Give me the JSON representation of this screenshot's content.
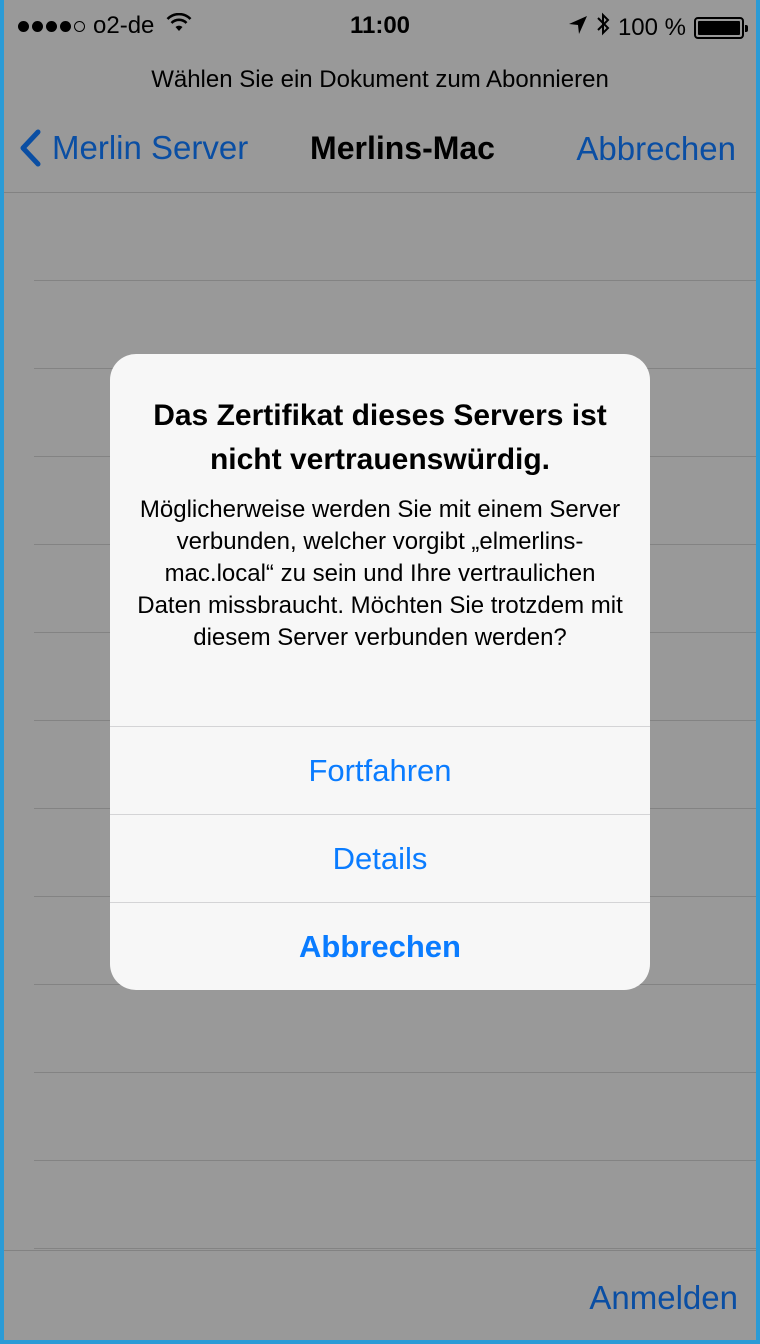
{
  "status_bar": {
    "carrier": "o2-de",
    "time": "11:00",
    "battery": "100 %",
    "signal_bars": 4,
    "signal_total": 5,
    "icons": [
      "wifi-icon",
      "location-icon",
      "bluetooth-icon",
      "battery-icon"
    ]
  },
  "prompt": "Wählen Sie ein Dokument zum Abonnieren",
  "navbar": {
    "back_label": "Merlin Server",
    "title": "Merlins-Mac",
    "cancel_label": "Abbrechen"
  },
  "toolbar": {
    "login_label": "Anmelden"
  },
  "alert": {
    "title": "Das Zertifikat dieses Servers ist nicht vertrauenswürdig.",
    "message": "Möglicherweise werden Sie mit einem Server verbunden, welcher vorgibt „elmerlins-mac.local“ zu sein und Ihre vertraulichen Daten missbraucht. Möchten Sie trotzdem mit diesem Server verbunden werden?",
    "buttons": {
      "continue": "Fortfahren",
      "details": "Details",
      "cancel": "Abbrechen"
    }
  },
  "colors": {
    "accent": "#0a7cff",
    "dimmed_accent": "#0a4ea3",
    "overlay_background": "#999999"
  }
}
